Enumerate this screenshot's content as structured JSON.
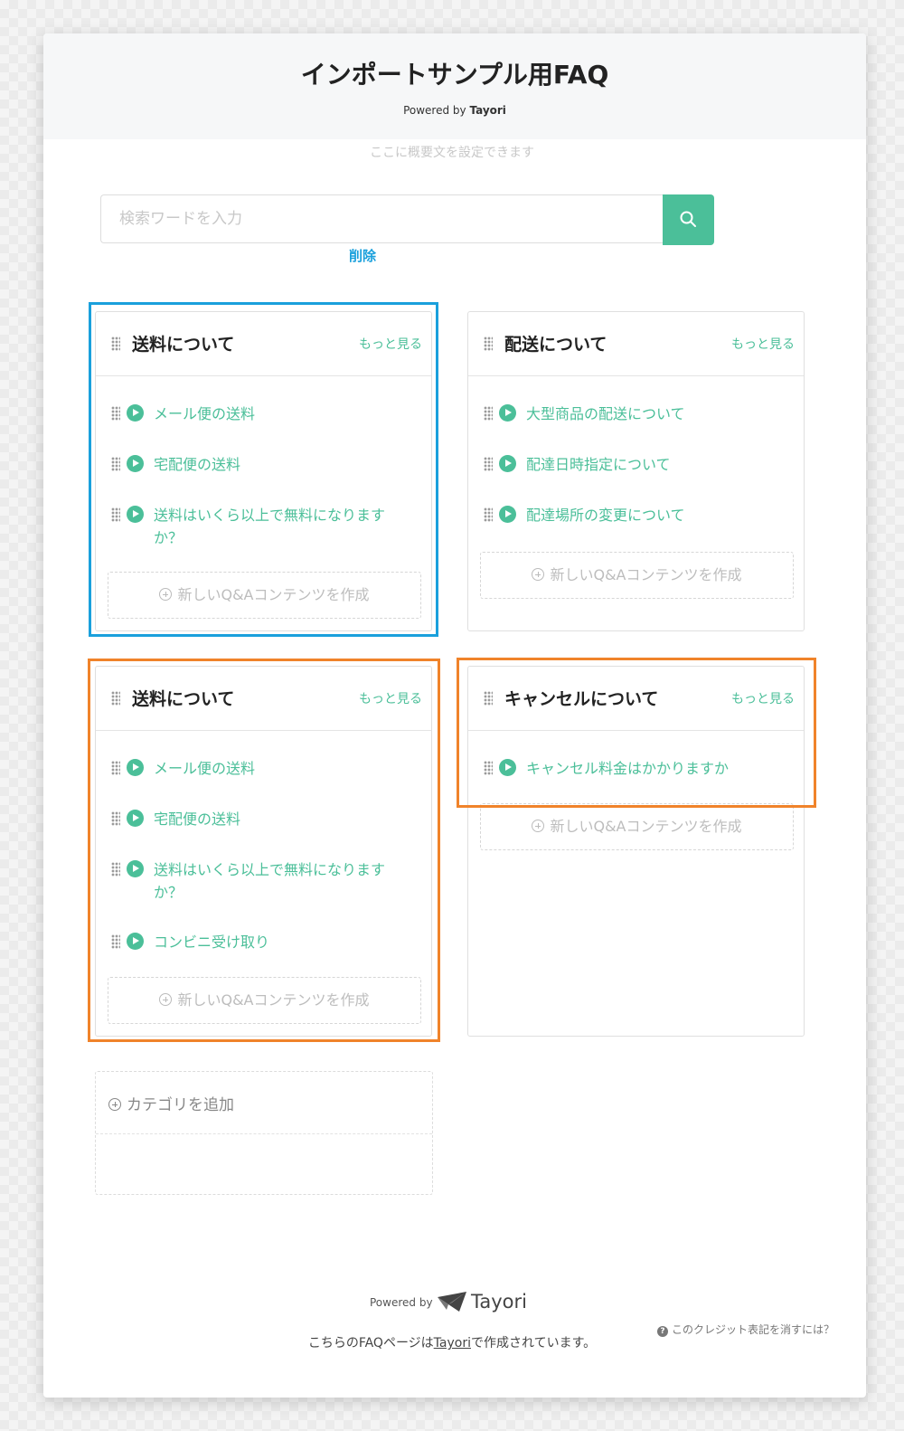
{
  "header": {
    "title": "インポートサンプル用FAQ",
    "powered_prefix": "Powered by",
    "powered_brand": "Tayori"
  },
  "description": "ここに概要文を設定できます",
  "search": {
    "placeholder": "検索ワードを入力"
  },
  "annotations": {
    "delete_label": "削除",
    "delete_color": "#1aa0dc",
    "highlight_orange": "#f0832a"
  },
  "more_label": "もっと見る",
  "new_content_label": "新しいQ&Aコンテンツを作成",
  "categories": [
    {
      "title": "送料について",
      "questions": [
        "メール便の送料",
        "宅配便の送料",
        "送料はいくら以上で無料になりますか？"
      ]
    },
    {
      "title": "配送について",
      "questions": [
        "大型商品の配送について",
        "配達日時指定について",
        "配達場所の変更について"
      ]
    },
    {
      "title": "送料について",
      "questions": [
        "メール便の送料",
        "宅配便の送料",
        "送料はいくら以上で無料になりますか？",
        "コンビニ受け取り"
      ]
    },
    {
      "title": "キャンセルについて",
      "questions": [
        "キャンセル料金はかかりますか"
      ]
    }
  ],
  "add_category_label": "カテゴリを追加",
  "footer": {
    "powered_prefix": "Powered by",
    "brand": "Tayori",
    "text_before": "こちらのFAQページは",
    "text_link": "Tayori",
    "text_after": "で作成されています。",
    "credit_link": "このクレジット表記を消すには？"
  },
  "colors": {
    "accent": "#4bbf99",
    "title": "#222222",
    "placeholder": "#c8c8c8"
  }
}
